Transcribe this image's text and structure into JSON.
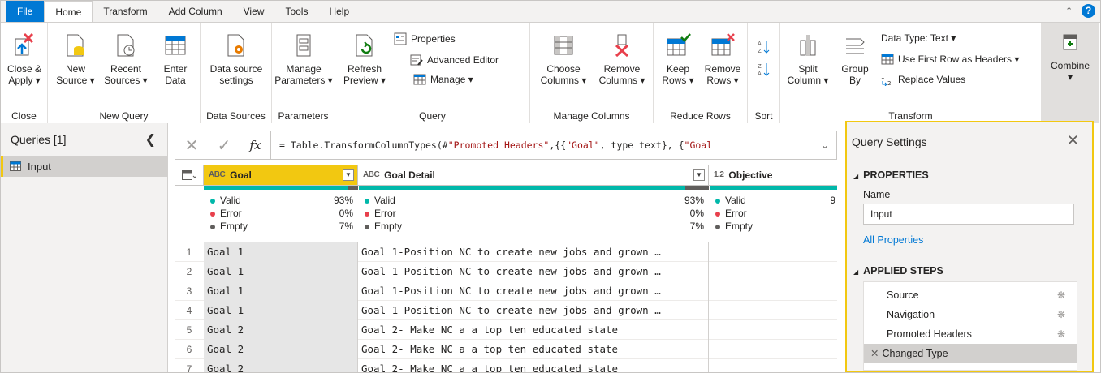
{
  "tabs": [
    "File",
    "Home",
    "Transform",
    "Add Column",
    "View",
    "Tools",
    "Help"
  ],
  "ribbon": {
    "groups": {
      "close": "Close",
      "new_query": "New Query",
      "data_sources": "Data Sources",
      "parameters": "Parameters",
      "query": "Query",
      "manage_columns": "Manage Columns",
      "reduce_rows": "Reduce Rows",
      "sort": "Sort",
      "transform": "Transform"
    },
    "close_apply": [
      "Close &",
      "Apply ▾"
    ],
    "new_source": [
      "New",
      "Source ▾"
    ],
    "recent_sources": [
      "Recent",
      "Sources ▾"
    ],
    "enter_data": [
      "Enter",
      "Data"
    ],
    "data_source_settings": [
      "Data source",
      "settings"
    ],
    "manage_parameters": [
      "Manage",
      "Parameters ▾"
    ],
    "refresh_preview": [
      "Refresh",
      "Preview ▾"
    ],
    "properties": "Properties",
    "advanced_editor": "Advanced Editor",
    "manage": "Manage ▾",
    "choose_columns": [
      "Choose",
      "Columns ▾"
    ],
    "remove_columns": [
      "Remove",
      "Columns ▾"
    ],
    "keep_rows": [
      "Keep",
      "Rows ▾"
    ],
    "remove_rows": [
      "Remove",
      "Rows ▾"
    ],
    "split_column": [
      "Split",
      "Column ▾"
    ],
    "group_by": [
      "Group",
      "By"
    ],
    "data_type": "Data Type: Text ▾",
    "use_first_row": "Use First Row as Headers ▾",
    "replace_values": "Replace Values",
    "combine": "Combine"
  },
  "queries": {
    "header": "Queries [1]",
    "items": [
      "Input"
    ]
  },
  "formula": {
    "fx": "fx",
    "prefix": "= Table.TransformColumnTypes(#",
    "s1": "\"Promoted Headers\"",
    "mid1": ",{{",
    "s2": "\"Goal\"",
    "mid2": ", type text}, {",
    "s3": "\"Goal"
  },
  "grid": {
    "columns": [
      {
        "type": "ABC",
        "name": "Goal",
        "valid": "93%",
        "error": "0%",
        "empty": "7%"
      },
      {
        "type": "ABC",
        "name": "Goal Detail",
        "valid": "93%",
        "error": "0%",
        "empty": "7%"
      },
      {
        "type": "1.2",
        "name": "Objective",
        "valid": "9",
        "error": "",
        "empty": ""
      }
    ],
    "labels": {
      "valid": "Valid",
      "error": "Error",
      "empty": "Empty"
    },
    "rows": [
      {
        "n": "1",
        "goal": "Goal 1",
        "detail": "Goal 1-Position NC to create new jobs and grown …"
      },
      {
        "n": "2",
        "goal": "Goal 1",
        "detail": "Goal 1-Position NC to create new jobs and grown …"
      },
      {
        "n": "3",
        "goal": "Goal 1",
        "detail": "Goal 1-Position NC to create new jobs and grown …"
      },
      {
        "n": "4",
        "goal": "Goal 1",
        "detail": "Goal 1-Position NC to create new jobs and grown …"
      },
      {
        "n": "5",
        "goal": "Goal 2",
        "detail": "Goal 2- Make NC a a top ten educated state"
      },
      {
        "n": "6",
        "goal": "Goal 2",
        "detail": "Goal 2- Make NC a a top ten educated state"
      },
      {
        "n": "7",
        "goal": "Goal 2",
        "detail": "Goal 2- Make NC a a top ten educated state"
      }
    ]
  },
  "settings": {
    "title": "Query Settings",
    "properties": "PROPERTIES",
    "name_label": "Name",
    "name_value": "Input",
    "all_properties": "All Properties",
    "applied_steps": "APPLIED STEPS",
    "steps": [
      "Source",
      "Navigation",
      "Promoted Headers",
      "Changed Type"
    ]
  },
  "colors": {
    "accent": "#0078d4",
    "highlight": "#f2c811",
    "valid": "#01b8aa",
    "error": "#e8404c",
    "empty": "#605e5c"
  }
}
